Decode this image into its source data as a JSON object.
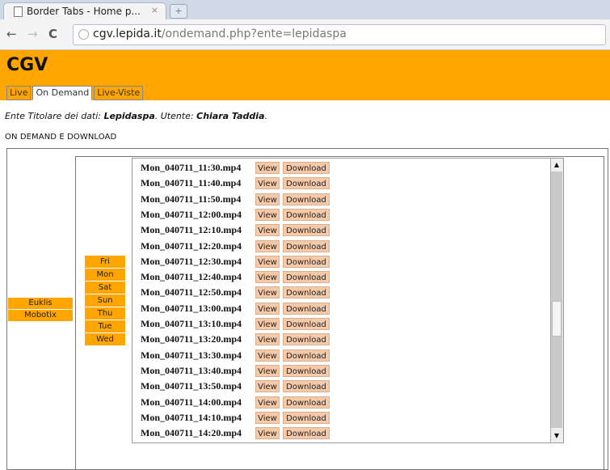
{
  "browser": {
    "tab_title": "Border Tabs - Home p...",
    "tab_close": "×",
    "new_tab": "+",
    "url_host": "cgv.lepida.it",
    "url_path": "/ondemand.php?ente=lepidaspa",
    "back_icon": "←",
    "forward_icon": "→",
    "reload_icon": "C"
  },
  "header": {
    "brand": "CGV",
    "tabs": [
      {
        "label": "Live"
      },
      {
        "label": "On Demand",
        "active": true
      },
      {
        "label": "Live-Viste"
      }
    ]
  },
  "owner": {
    "prefix": "Ente Titolare dei dati: ",
    "ente": "Lepidaspa",
    "mid": ".  Utente: ",
    "user": "Chiara Taddia",
    "suffix": "."
  },
  "section_title": "ON DEMAND E DOWNLOAD",
  "cameras": [
    "Euklis",
    "Mobotix"
  ],
  "days": [
    "Fri",
    "Mon",
    "Sat",
    "Sun",
    "Thu",
    "Tue",
    "Wed"
  ],
  "button_labels": {
    "view": "View",
    "download": "Download"
  },
  "files": [
    "Mon_040711_11:30.mp4",
    "Mon_040711_11:40.mp4",
    "Mon_040711_11:50.mp4",
    "Mon_040711_12:00.mp4",
    "Mon_040711_12:10.mp4",
    "Mon_040711_12:20.mp4",
    "Mon_040711_12:30.mp4",
    "Mon_040711_12:40.mp4",
    "Mon_040711_12:50.mp4",
    "Mon_040711_13:00.mp4",
    "Mon_040711_13:10.mp4",
    "Mon_040711_13:20.mp4",
    "Mon_040711_13:30.mp4",
    "Mon_040711_13:40.mp4",
    "Mon_040711_13:50.mp4",
    "Mon_040711_14:00.mp4",
    "Mon_040711_14:10.mp4",
    "Mon_040711_14:20.mp4"
  ]
}
